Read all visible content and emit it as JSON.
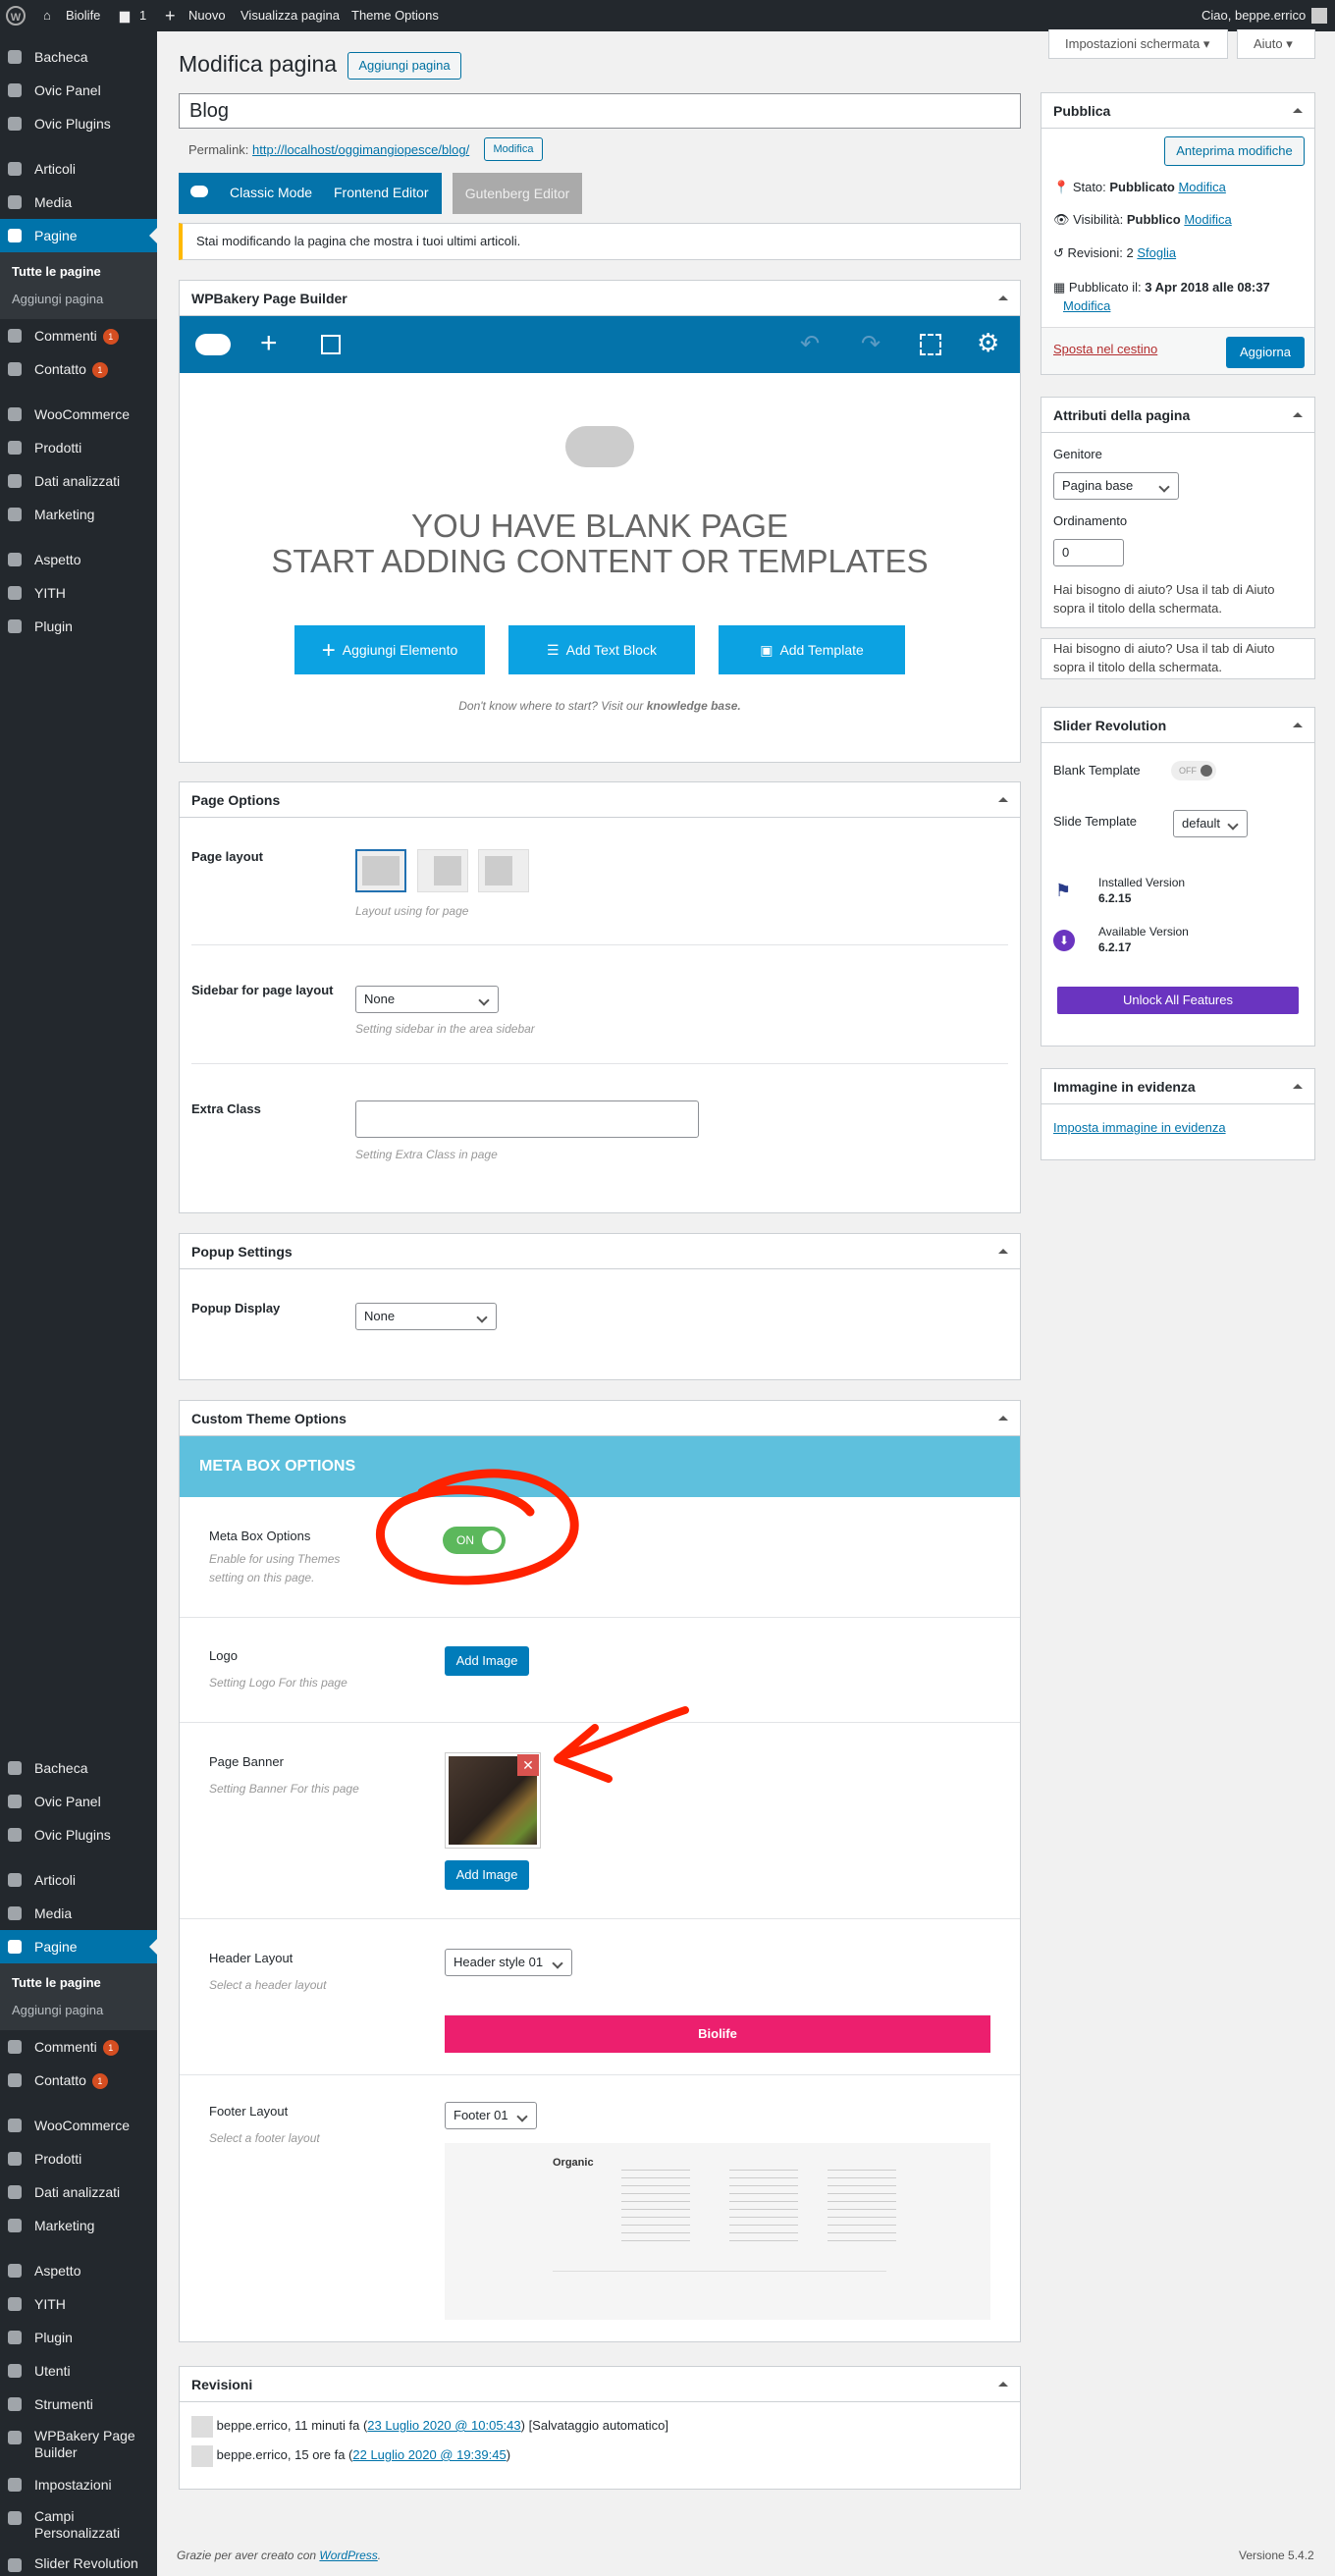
{
  "adminbar": {
    "site": "Biolife",
    "comments": "1",
    "new": "Nuovo",
    "view_page": "Visualizza pagina",
    "theme_options": "Theme Options",
    "greeting": "Ciao, beppe.errico"
  },
  "screen_options": "Impostazioni schermata",
  "help": "Aiuto",
  "sidebar": {
    "items": [
      {
        "label": "Bacheca",
        "type": "item"
      },
      {
        "label": "Ovic Panel",
        "type": "item"
      },
      {
        "label": "Ovic Plugins",
        "type": "item"
      },
      {
        "label": "Articoli",
        "type": "item"
      },
      {
        "label": "Media",
        "type": "item"
      },
      {
        "label": "Pagine",
        "type": "active"
      },
      {
        "label": "Commenti",
        "type": "item",
        "badge": "1"
      },
      {
        "label": "Contatto",
        "type": "item",
        "badge": "1"
      },
      {
        "label": "WooCommerce",
        "type": "item"
      },
      {
        "label": "Prodotti",
        "type": "item"
      },
      {
        "label": "Dati analizzati",
        "type": "item"
      },
      {
        "label": "Marketing",
        "type": "item"
      },
      {
        "label": "Aspetto",
        "type": "item"
      },
      {
        "label": "YITH",
        "type": "item"
      },
      {
        "label": "Plugin",
        "type": "item"
      }
    ],
    "sub": [
      "Tutte le pagine",
      "Aggiungi pagina"
    ],
    "items2": [
      "Utenti",
      "Strumenti",
      "WPBakery Page Builder",
      "Impostazioni",
      "Campi Personalizzati",
      "Slider Revolution"
    ]
  },
  "page": {
    "heading": "Modifica pagina",
    "add_new": "Aggiungi pagina",
    "title_value": "Blog",
    "permalink_label": "Permalink:",
    "permalink_url": "http://localhost/oggimangiopesce/blog/",
    "permalink_edit": "Modifica",
    "classic": "Classic Mode",
    "frontend": "Frontend Editor",
    "gutenberg": "Gutenberg Editor",
    "notice": "Stai modificando la pagina che mostra i tuoi ultimi articoli."
  },
  "wpb": {
    "title": "WPBakery Page Builder",
    "blank1": "YOU HAVE BLANK PAGE",
    "blank2": "START ADDING CONTENT OR TEMPLATES",
    "add_element": "Aggiungi Elemento",
    "add_text": "Add Text Block",
    "add_template": "Add Template",
    "help1": "Don't know where to start? Visit our",
    "help2": "knowledge base."
  },
  "page_options": {
    "title": "Page Options",
    "layout_label": "Page layout",
    "layout_desc": "Layout using for page",
    "sidebar_label": "Sidebar for page layout",
    "sidebar_value": "None",
    "sidebar_desc": "Setting sidebar in the area sidebar",
    "extra_label": "Extra Class",
    "extra_desc": "Setting Extra Class in page"
  },
  "popup": {
    "title": "Popup Settings",
    "label": "Popup Display",
    "value": "None"
  },
  "cto": {
    "title": "Custom Theme Options",
    "banner": "META BOX OPTIONS",
    "meta_label": "Meta Box Options",
    "meta_desc": "Enable for using Themes setting on this page.",
    "toggle": "ON",
    "logo_label": "Logo",
    "logo_desc": "Setting Logo For this page",
    "add_image": "Add Image",
    "banner_label": "Page Banner",
    "banner_desc": "Setting Banner For this page",
    "header_label": "Header Layout",
    "header_desc": "Select a header layout",
    "header_value": "Header style 01",
    "footer_label": "Footer Layout",
    "footer_desc": "Select a footer layout",
    "footer_value": "Footer 01",
    "header_logo": "Biolife",
    "footer_logo": "Organic"
  },
  "revisions": {
    "title": "Revisioni",
    "rows": [
      {
        "text": "beppe.errico, 11 minuti fa (",
        "link": "23 Luglio 2020 @ 10:05:43",
        "tail": ") [Salvataggio automatico]"
      },
      {
        "text": "beppe.errico, 15 ore fa (",
        "link": "22 Luglio 2020 @ 19:39:45",
        "tail": ")"
      }
    ]
  },
  "publish": {
    "title": "Pubblica",
    "preview": "Anteprima modifiche",
    "status": "Stato: ",
    "status_val": "Pubblicato",
    "visibility": "Visibilità: ",
    "vis_val": "Pubblico",
    "revisions": "Revisioni: 2",
    "browse": "Sfoglia",
    "published": "Pubblicato il: ",
    "pub_date": "3 Apr 2018 alle 08:37",
    "edit": "Modifica",
    "trash": "Sposta nel cestino",
    "update": "Aggiorna"
  },
  "attributes": {
    "title": "Attributi della pagina",
    "parent": "Genitore",
    "parent_val": "Pagina base",
    "order": "Ordinamento",
    "order_val": "0",
    "help": "Hai bisogno di aiuto? Usa il tab di Aiuto sopra il titolo della schermata."
  },
  "revslider": {
    "title": "Slider Revolution",
    "blank": "Blank Template",
    "off": "OFF",
    "slide": "Slide Template",
    "slide_val": "default",
    "installed": "Installed Version",
    "installed_v": "6.2.15",
    "available": "Available Version",
    "available_v": "6.2.17",
    "unlock": "Unlock All Features"
  },
  "featured": {
    "title": "Immagine in evidenza",
    "link": "Imposta immagine in evidenza"
  },
  "footer": {
    "thanks": "Grazie per aver creato con ",
    "wp": "WordPress",
    "version": "Versione 5.4.2"
  },
  "colors": {
    "accent": "#0073aa",
    "wpb_blue": "#0473aa",
    "cto_banner": "#5ec0dd",
    "toggle": "#5cb85c",
    "annotation": "#ff2200",
    "unlock": "#6a34c0"
  }
}
